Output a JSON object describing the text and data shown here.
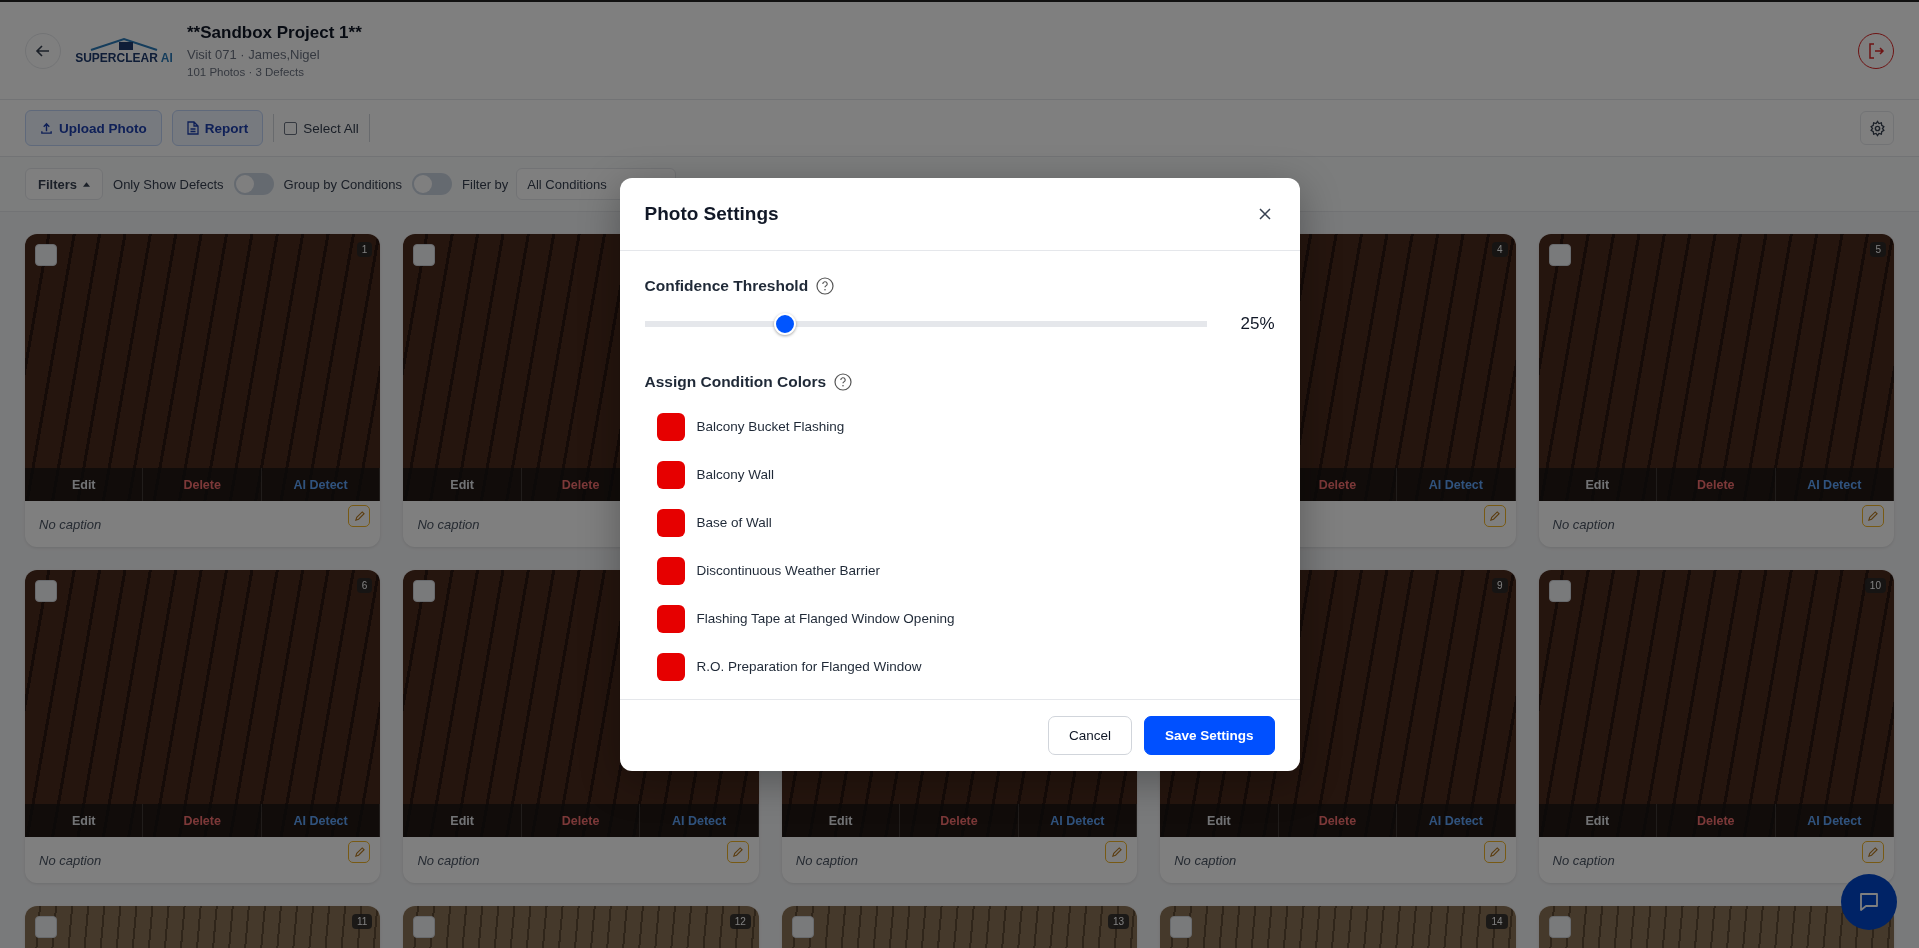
{
  "header": {
    "title": "**Sandbox Project 1**",
    "logo": {
      "name": "SUPERCLEAR",
      "suffix": "AI"
    },
    "subtitle": "Visit 071 · James,Nigel",
    "stats": "101 Photos · 3 Defects"
  },
  "toolbar": {
    "buttons": [
      {
        "label": "Upload Photo",
        "kind": "upload"
      },
      {
        "label": "Report",
        "kind": "report"
      }
    ],
    "select_all": {
      "label": "Select All",
      "checked": false
    }
  },
  "filters": {
    "button": "Filters",
    "expanded": true,
    "toggles": [
      {
        "label": "Only Show Defects",
        "on": false
      },
      {
        "label": "Group by Conditions",
        "on": false
      }
    ],
    "filter_label": "Filter by",
    "filter_value": "All Conditions"
  },
  "photos": [
    {
      "badge": "1",
      "checked": false,
      "actions": [
        {
          "kind": "edit",
          "label": "Edit"
        },
        {
          "kind": "delete",
          "label": "Delete"
        },
        {
          "kind": "ai",
          "label": "AI Detect"
        }
      ],
      "caption": "No caption"
    },
    {
      "checked": false,
      "actions": [
        {
          "kind": "edit",
          "label": "Edit"
        },
        {
          "kind": "delete",
          "label": "Delete"
        }
      ],
      "caption": "No caption"
    },
    {
      "badge": "4",
      "actions": [
        {
          "kind": "delete",
          "label": "Delete"
        },
        {
          "kind": "ai",
          "label": "AI Detect"
        }
      ]
    },
    {
      "badge": "5",
      "checked": false,
      "actions": [
        {
          "kind": "edit",
          "label": "Edit"
        },
        {
          "kind": "delete",
          "label": "Delete"
        },
        {
          "kind": "ai",
          "label": "AI Detect"
        }
      ],
      "caption": "No caption"
    },
    {
      "badge": "6",
      "checked": false,
      "actions": [
        {
          "kind": "edit",
          "label": "Edit"
        },
        {
          "kind": "delete",
          "label": "Delete"
        },
        {
          "kind": "ai",
          "label": "AI Detect"
        }
      ],
      "caption": "No caption"
    },
    {
      "checked": false,
      "actions": [
        {
          "kind": "edit",
          "label": "Edit"
        },
        {
          "kind": "delete",
          "label": "Delete"
        },
        {
          "kind": "ai",
          "label": "AI Detect"
        }
      ],
      "caption": "No caption"
    },
    {
      "actions": [
        {
          "kind": "edit",
          "label": "Edit"
        },
        {
          "kind": "delete",
          "label": "Delete"
        },
        {
          "kind": "ai",
          "label": "AI Detect"
        }
      ],
      "caption": "No caption"
    },
    {
      "badge": "9",
      "actions": [
        {
          "kind": "edit",
          "label": "Edit"
        },
        {
          "kind": "delete",
          "label": "Delete"
        },
        {
          "kind": "ai",
          "label": "AI Detect"
        }
      ],
      "caption": "No caption"
    },
    {
      "badge": "10",
      "checked": false,
      "actions": [
        {
          "kind": "edit",
          "label": "Edit"
        },
        {
          "kind": "delete",
          "label": "Delete"
        },
        {
          "kind": "ai",
          "label": "AI Detect"
        }
      ],
      "caption": "No caption"
    },
    {
      "badge": "11",
      "checked": false
    },
    {
      "badge": "12",
      "checked": false
    },
    {
      "badge": "13",
      "checked": false
    },
    {
      "badge": "14",
      "checked": false
    },
    {
      "checked": false
    }
  ],
  "dialog": {
    "title": "Photo Settings",
    "threshold": {
      "label": "Confidence Threshold",
      "level": 0.25,
      "reading": "25%"
    },
    "colors_title": "Assign Condition Colors",
    "conditions": [
      {
        "name": "Balcony Bucket Flashing",
        "color": "#e60000"
      },
      {
        "name": "Balcony Wall",
        "color": "#e60000"
      },
      {
        "name": "Base of Wall",
        "color": "#e60000"
      },
      {
        "name": "Discontinuous Weather Barrier",
        "color": "#e60000"
      },
      {
        "name": "Flashing Tape at Flanged Window Opening",
        "color": "#e60000"
      },
      {
        "name": "R.O. Preparation for Flanged Window",
        "color": "#e60000"
      }
    ],
    "buttons": [
      {
        "label": "Cancel",
        "kind": "secondary"
      },
      {
        "label": "Save Settings",
        "kind": "primary"
      }
    ]
  }
}
